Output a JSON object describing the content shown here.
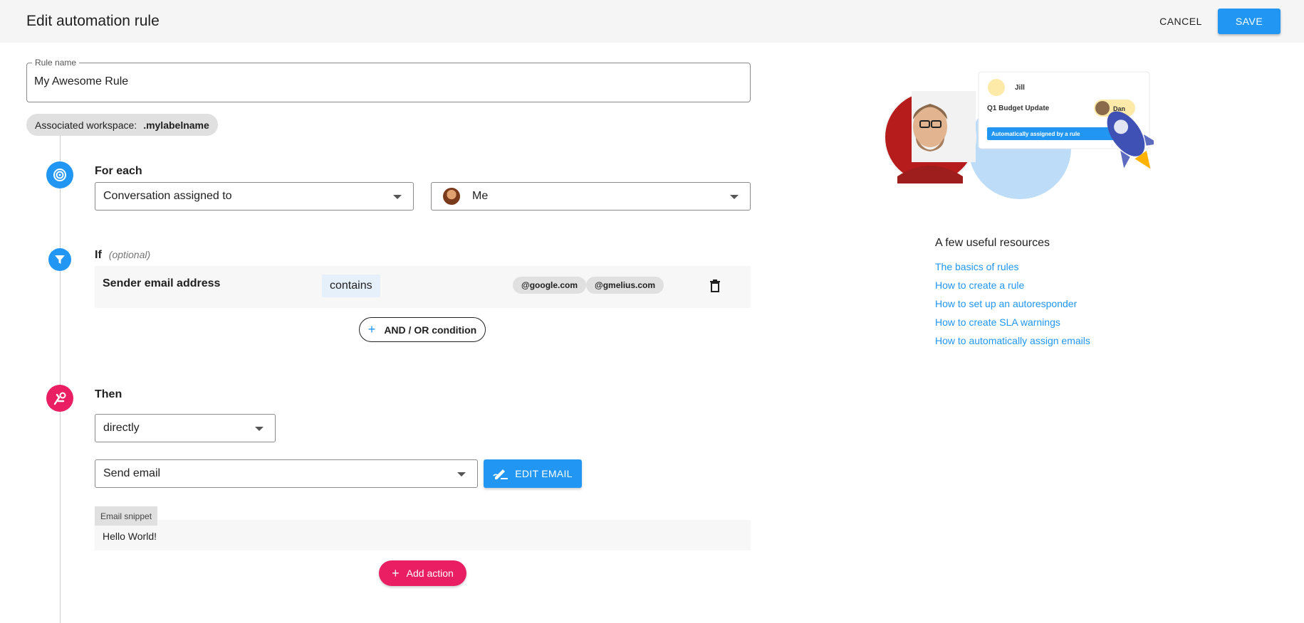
{
  "header": {
    "title": "Edit automation rule",
    "cancel_label": "CANCEL",
    "save_label": "SAVE"
  },
  "rule_name": {
    "label": "Rule name",
    "value": "My Awesome Rule"
  },
  "workspace": {
    "label": "Associated workspace:",
    "value": ".mylabelname"
  },
  "for_each": {
    "label": "For each",
    "trigger_value": "Conversation assigned to",
    "assignee_value": "Me"
  },
  "condition": {
    "label": "If",
    "optional": "(optional)",
    "field": "Sender email address",
    "operator": "contains",
    "values": [
      "@google.com",
      "@gmelius.com"
    ],
    "add_condition_label": "AND / OR condition"
  },
  "then": {
    "label": "Then",
    "timing_value": "directly",
    "action_value": "Send email",
    "edit_email_label": "EDIT EMAIL",
    "snippet_label": "Email snippet",
    "snippet_text": "Hello World!",
    "add_action_label": "Add action"
  },
  "illustration": {
    "card_name": "Jill",
    "card_subject": "Q1 Budget Update",
    "card_assignee": "Dan",
    "card_banner": "Automatically assigned by a rule"
  },
  "resources": {
    "title": "A few useful resources",
    "links": [
      "The basics of rules",
      "How to create a rule",
      "How to set up an autoresponder",
      "How to create SLA warnings",
      "How to automatically assign emails"
    ]
  },
  "colors": {
    "primary": "#2196f3",
    "accent": "#e91e63"
  }
}
